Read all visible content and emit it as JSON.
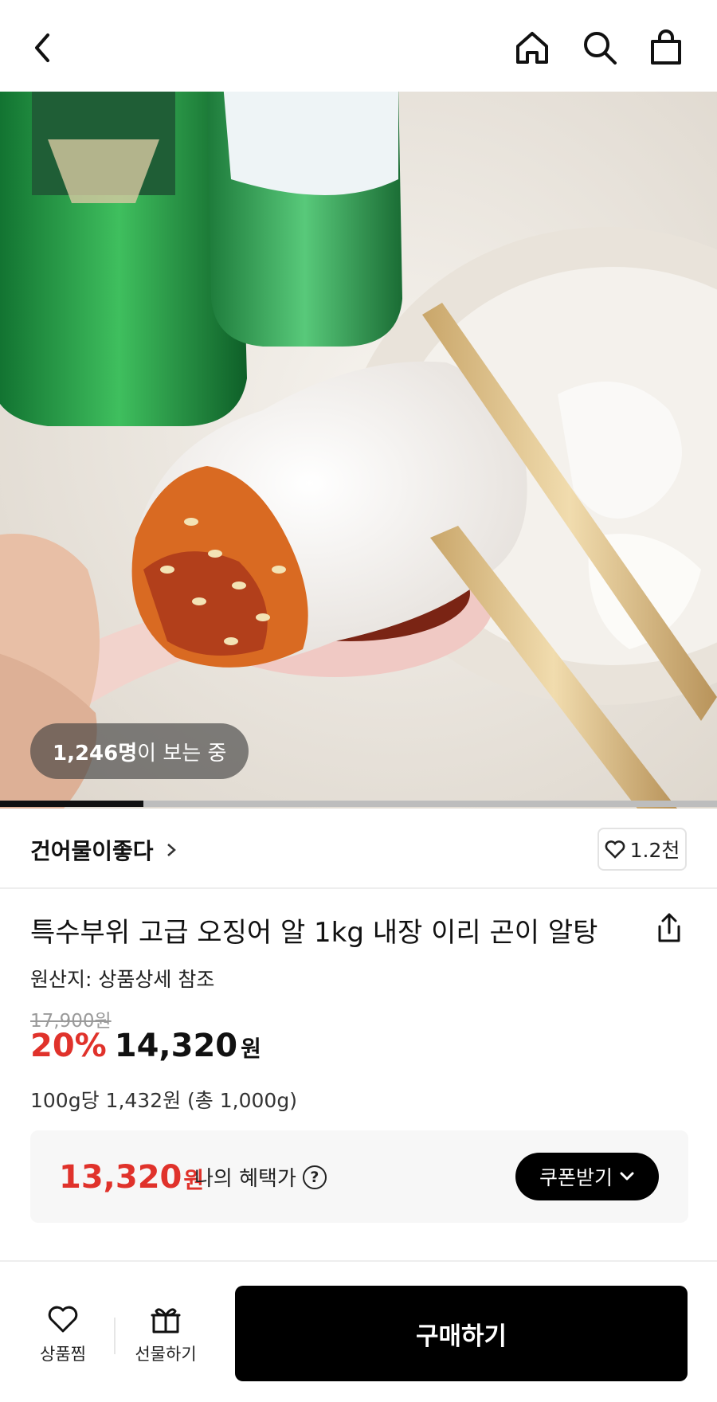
{
  "header": {
    "icons": [
      "back-icon",
      "home-icon",
      "search-icon",
      "shopping-bag-icon"
    ]
  },
  "hero": {
    "viewers_count": "1,246명",
    "viewers_suffix": "이 보는 중",
    "slide_progress": 0.2
  },
  "seller": {
    "name": "건어물이좋다",
    "like_count": "1.2천"
  },
  "product": {
    "title": "특수부위 고급 오징어 알 1kg 내장 이리 곤이 알탕",
    "origin": "원산지: 상품상세 참조",
    "original_price": "17,900원",
    "discount": "20%",
    "price": "14,320",
    "price_unit": "원",
    "unit_price": "100g당 1,432원 (총 1,000g)"
  },
  "benefit": {
    "amount": "13,320",
    "unit": "원",
    "label": "나의 혜택가",
    "help_glyph": "?",
    "coupon_label": "쿠폰받기"
  },
  "bottom_bar": {
    "wish_label": "상품찜",
    "gift_label": "선물하기",
    "buy_label": "구매하기"
  },
  "colors": {
    "accent_red": "#e0322b",
    "primary_black": "#000000",
    "muted_gray": "#9a9a9a"
  }
}
